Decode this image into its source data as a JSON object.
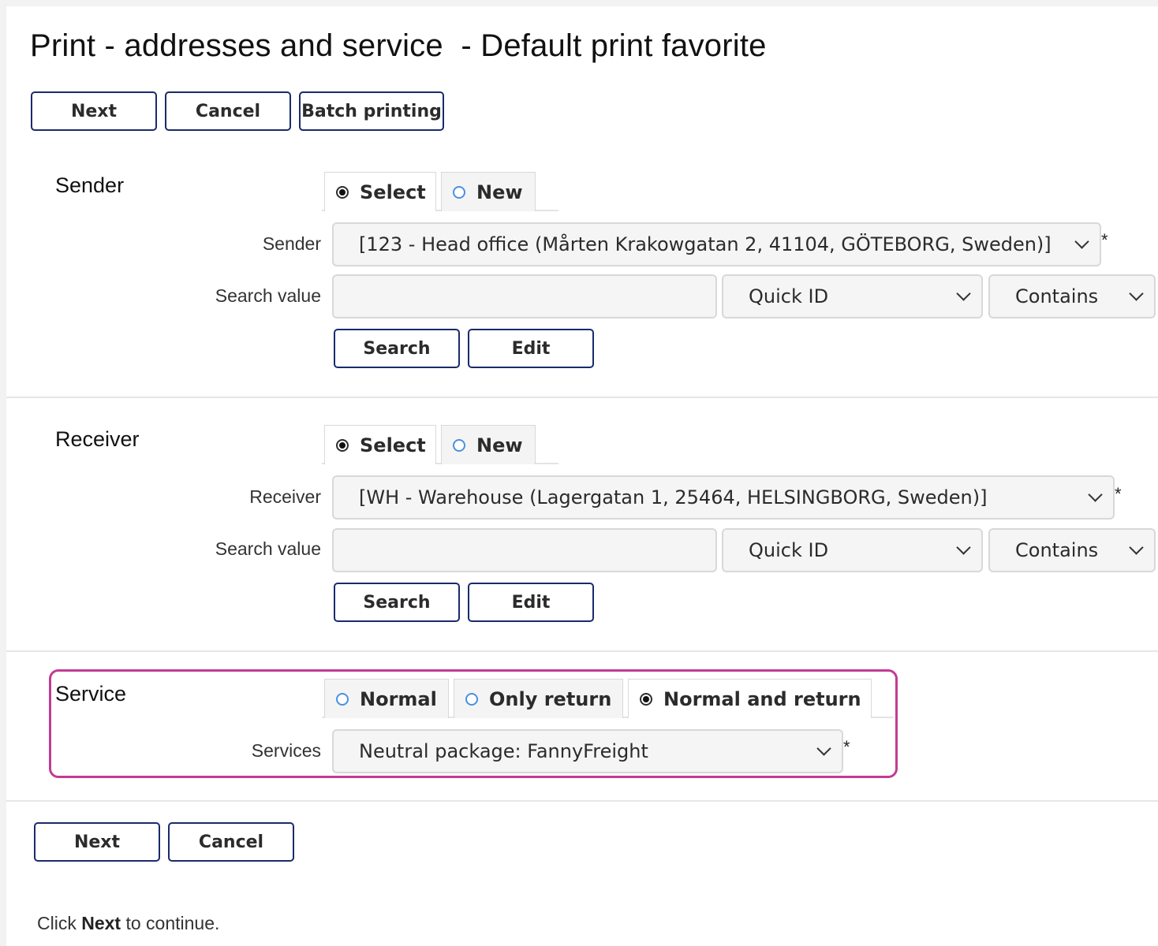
{
  "page": {
    "title": "Print - addresses and service  - Default print favorite"
  },
  "top_actions": {
    "next": "Next",
    "cancel": "Cancel",
    "batch": "Batch printing"
  },
  "sender": {
    "section_label": "Sender",
    "tabs": [
      {
        "label": "Select",
        "selected": true
      },
      {
        "label": "New",
        "selected": false
      }
    ],
    "field_label": "Sender",
    "value": "[123 - Head office (Mårten Krakowgatan 2, 41104, GÖTEBORG, Sweden)]",
    "required_mark": "*",
    "search_label": "Search value",
    "search_value": "",
    "search_field": "Quick ID",
    "search_match": "Contains",
    "search_button": "Search",
    "edit_button": "Edit"
  },
  "receiver": {
    "section_label": "Receiver",
    "tabs": [
      {
        "label": "Select",
        "selected": true
      },
      {
        "label": "New",
        "selected": false
      }
    ],
    "field_label": "Receiver",
    "value": "[WH - Warehouse (Lagergatan 1, 25464, HELSINGBORG, Sweden)]",
    "required_mark": "*",
    "search_label": "Search value",
    "search_value": "",
    "search_field": "Quick ID",
    "search_match": "Contains",
    "search_button": "Search",
    "edit_button": "Edit"
  },
  "service": {
    "section_label": "Service",
    "tabs": [
      {
        "label": "Normal",
        "selected": false
      },
      {
        "label": "Only return",
        "selected": false
      },
      {
        "label": "Normal and return",
        "selected": true
      }
    ],
    "field_label": "Services",
    "value": "Neutral package: FannyFreight",
    "required_mark": "*"
  },
  "bottom_actions": {
    "next": "Next",
    "cancel": "Cancel"
  },
  "footer": {
    "prefix": "Click ",
    "bold": "Next",
    "suffix": " to continue."
  },
  "colors": {
    "button_border": "#1a2a6c",
    "highlight_border": "#c23b94",
    "radio_unselected": "#4a90e2"
  }
}
